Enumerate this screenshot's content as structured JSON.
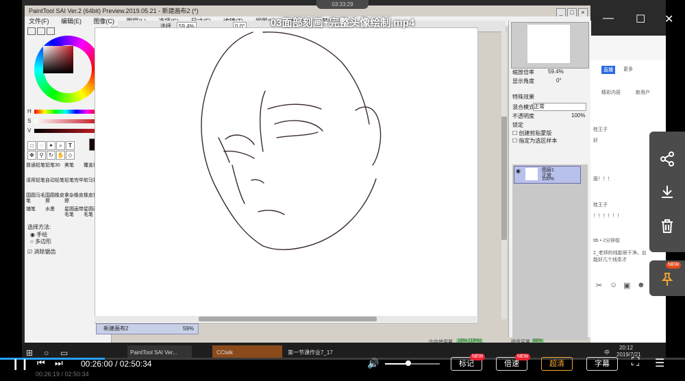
{
  "video": {
    "title": "03面部刻画+完整头像绘制.mp4",
    "recorder_time": "03:33:29",
    "current_time": "00:26:00",
    "separator": "/",
    "total_time": "02:50:34",
    "prev_time_ghost": "00:26:19 / 02:50:34",
    "progress_percent": 15.3
  },
  "sai": {
    "title": "PaintTool SAI Ver.2 (64bit) Preview.2019.05.21 - 新建画布2 (*)",
    "menu": [
      "文件(F)",
      "编辑(E)",
      "图像(C)",
      "图层(L)",
      "选择(S)",
      "尺寸(F)",
      "滤镜(T)",
      "视图(V)",
      "窗口(W)",
      "其他(O)"
    ],
    "zoom": "59.4%",
    "rotation": "0.0°",
    "select_label": "选择",
    "hsv": {
      "h_label": "H",
      "h": "011",
      "s_label": "S",
      "s": "046",
      "v_label": "V",
      "v": "012"
    },
    "brushes": [
      "普通铅笔",
      "铅笔30",
      "美笔",
      "覆盖铅笔",
      "请用铅笔",
      "自动铅笔",
      "铅笔完毕",
      "软马铅笔",
      "国圆马毛笔",
      "国圆橡皮擦",
      "拿杂橡皮擦",
      "橡皮擦",
      "铺笔",
      "水墨",
      "星圆画带毛笔",
      "星圆画格毛笔"
    ],
    "select_method_label": "选择方法:",
    "select_opt1": "手绘",
    "select_opt2": "多边形",
    "antialias_label": "消除锯齿",
    "canvas_tab": "新建画布2",
    "canvas_tab_zoom": "59%",
    "nav_zoom_label": "缩放倍率",
    "nav_zoom": "59.4%",
    "nav_angle_label": "显示角度",
    "nav_angle": "0°",
    "effects_label": "特殊效果",
    "blend_label": "混合模式",
    "blend_value": "正常",
    "opacity_label": "不透明度",
    "opacity_value": "100%",
    "lock_label": "锁定",
    "clip_label": "创建剪贴蒙版",
    "sample_label": "指定为选区样本",
    "layer_name": "图层1",
    "layer_mode": "正常",
    "layer_opacity": "100%",
    "status_mem_label": "内存使用量",
    "status_mem_value": "18% (19%)",
    "status_disk_label": "磁盘容量",
    "status_disk_value": "88%"
  },
  "taskbar": {
    "app1": "PaintTool SAI Ver...",
    "app2": "CCtalk",
    "app3": "第一节课作业7_17",
    "time": "20:12",
    "date": "2019/7/21",
    "ime": "中"
  },
  "sidebar": {
    "live": "直播",
    "more": "更多",
    "highlights": "精彩内容",
    "new_users": "新用户",
    "msgs": [
      "桂王子",
      "好",
      "面！！！",
      "桂王子",
      "！！！！！！",
      "ttb • 2分钟前",
      "2_老师的线能很干净。台",
      "能好几个线条才"
    ]
  },
  "controls": {
    "mark": "标记",
    "speed": "倍速",
    "quality": "超清",
    "subtitle": "字幕",
    "new_badge": "NEW",
    "pin_new": "NEW"
  }
}
